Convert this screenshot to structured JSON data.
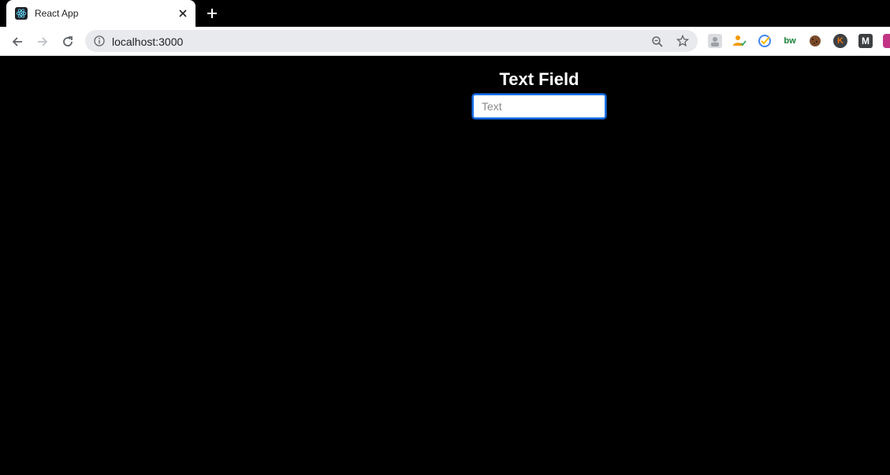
{
  "browser": {
    "tab": {
      "title": "React App",
      "favicon": "react-logo-icon"
    },
    "new_tab_label": "+",
    "url": "localhost:3000",
    "extensions": [
      {
        "name": "profile-extension-icon",
        "color": "#9aa0a6"
      },
      {
        "name": "user-check-extension-icon",
        "color": "#f29900"
      },
      {
        "name": "checkmark-circle-extension-icon",
        "color": "#4285f4"
      },
      {
        "name": "bw-extension-icon",
        "color": "#188038",
        "label": "bw"
      },
      {
        "name": "cookie-extension-icon",
        "color": "#7a4b2a"
      },
      {
        "name": "k-extension-icon",
        "color": "#3c4043",
        "label": "K"
      },
      {
        "name": "m-extension-icon",
        "color": "#3c4043",
        "label": "M"
      },
      {
        "name": "instagram-extension-icon",
        "color": "#c13584"
      }
    ]
  },
  "page": {
    "heading": "Text Field",
    "input": {
      "placeholder": "Text",
      "value": ""
    }
  },
  "colors": {
    "page_background": "#000000",
    "focus_ring": "#1a73e8"
  }
}
